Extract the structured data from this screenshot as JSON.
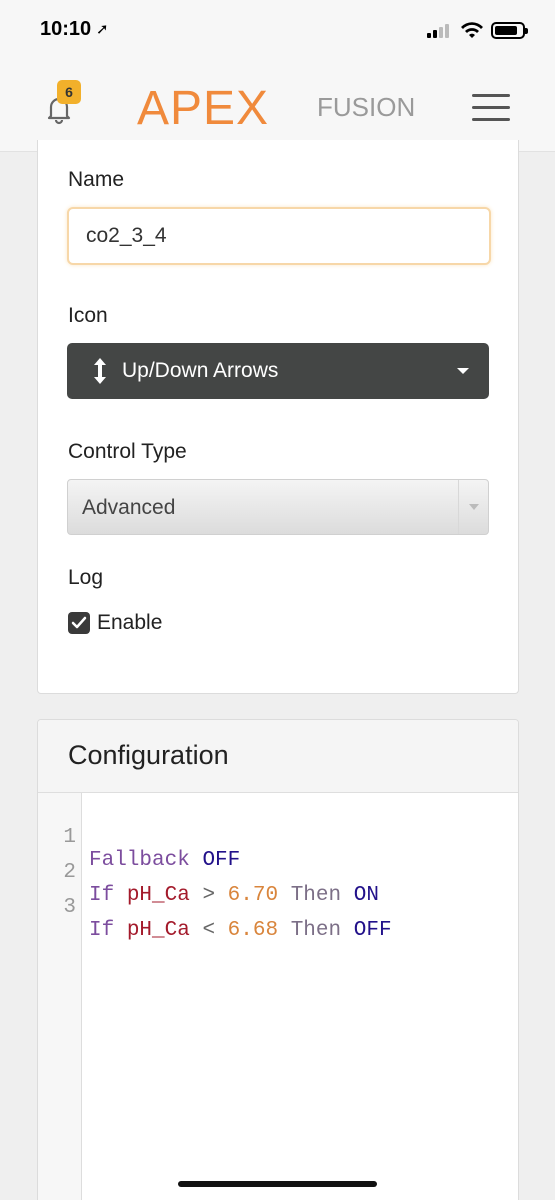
{
  "status": {
    "time": "10:10"
  },
  "header": {
    "notification_count": "6",
    "logo_primary": "APEX",
    "logo_secondary": "FUSION"
  },
  "form": {
    "name_label": "Name",
    "name_value": "co2_3_4",
    "icon_label": "Icon",
    "icon_value": "Up/Down Arrows",
    "control_type_label": "Control Type",
    "control_type_value": "Advanced",
    "log_label": "Log",
    "log_enable_label": "Enable",
    "log_enabled": true
  },
  "configuration": {
    "title": "Configuration",
    "lines": [
      {
        "num": "1",
        "t1": "Fallback",
        "t2": "OFF"
      },
      {
        "num": "2",
        "t1": "If",
        "t2": "pH_Ca",
        "t3": ">",
        "t4": "6.70",
        "t5": "Then",
        "t6": "ON"
      },
      {
        "num": "3",
        "t1": "If",
        "t2": "pH_Ca",
        "t3": "<",
        "t4": "6.68",
        "t5": "Then",
        "t6": "OFF"
      }
    ]
  },
  "colors": {
    "accent": "#f08a3c",
    "badge": "#f2b02b",
    "dark_select": "#444645"
  }
}
